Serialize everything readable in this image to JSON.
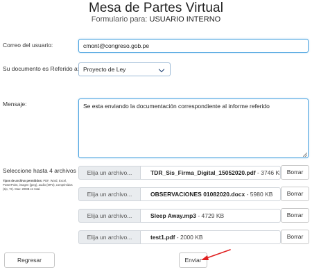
{
  "header": {
    "title": "Mesa de Partes Virtual",
    "subtitle_prefix": "Formulario para:",
    "subtitle_value": "USUARIO INTERNO"
  },
  "form": {
    "user_email": {
      "label": "Correo del usuario:",
      "value": "cmont@congreso.gob.pe"
    },
    "document_type": {
      "label": "Su documento es Referido a:",
      "selected": "Proyecto de Ley"
    },
    "message": {
      "label": "Mensaje:",
      "value": "Se esta enviando la documentación correspondiente al informe referido"
    },
    "files": {
      "label": "Seleccione hasta 4 archivos",
      "allowed_types_title": "Tipos de archivo permitidos:",
      "allowed_types_text": "PDF, Word, Excel, PowerPoint, imagen (jpeg), audio (MP3), comprimidos (zip, 7z). Max: 20MB en total.",
      "choose_label": "Elija un archivo...",
      "remove_label": "Borrar",
      "items": [
        {
          "name": "TDR_Sis_Firma_Digital_15052020.pdf",
          "size": "- 3746 KB"
        },
        {
          "name": "OBSERVACIONES 01082020.docx",
          "size": "- 5980 KB"
        },
        {
          "name": "Sleep Away.mp3",
          "size": "- 4729 KB"
        },
        {
          "name": "test1.pdf",
          "size": "- 2000 KB"
        }
      ]
    }
  },
  "actions": {
    "back_label": "Regresar",
    "submit_label": "Enviar"
  },
  "colors": {
    "focus_border": "#4aa3df",
    "annotation_arrow": "#e02020"
  }
}
